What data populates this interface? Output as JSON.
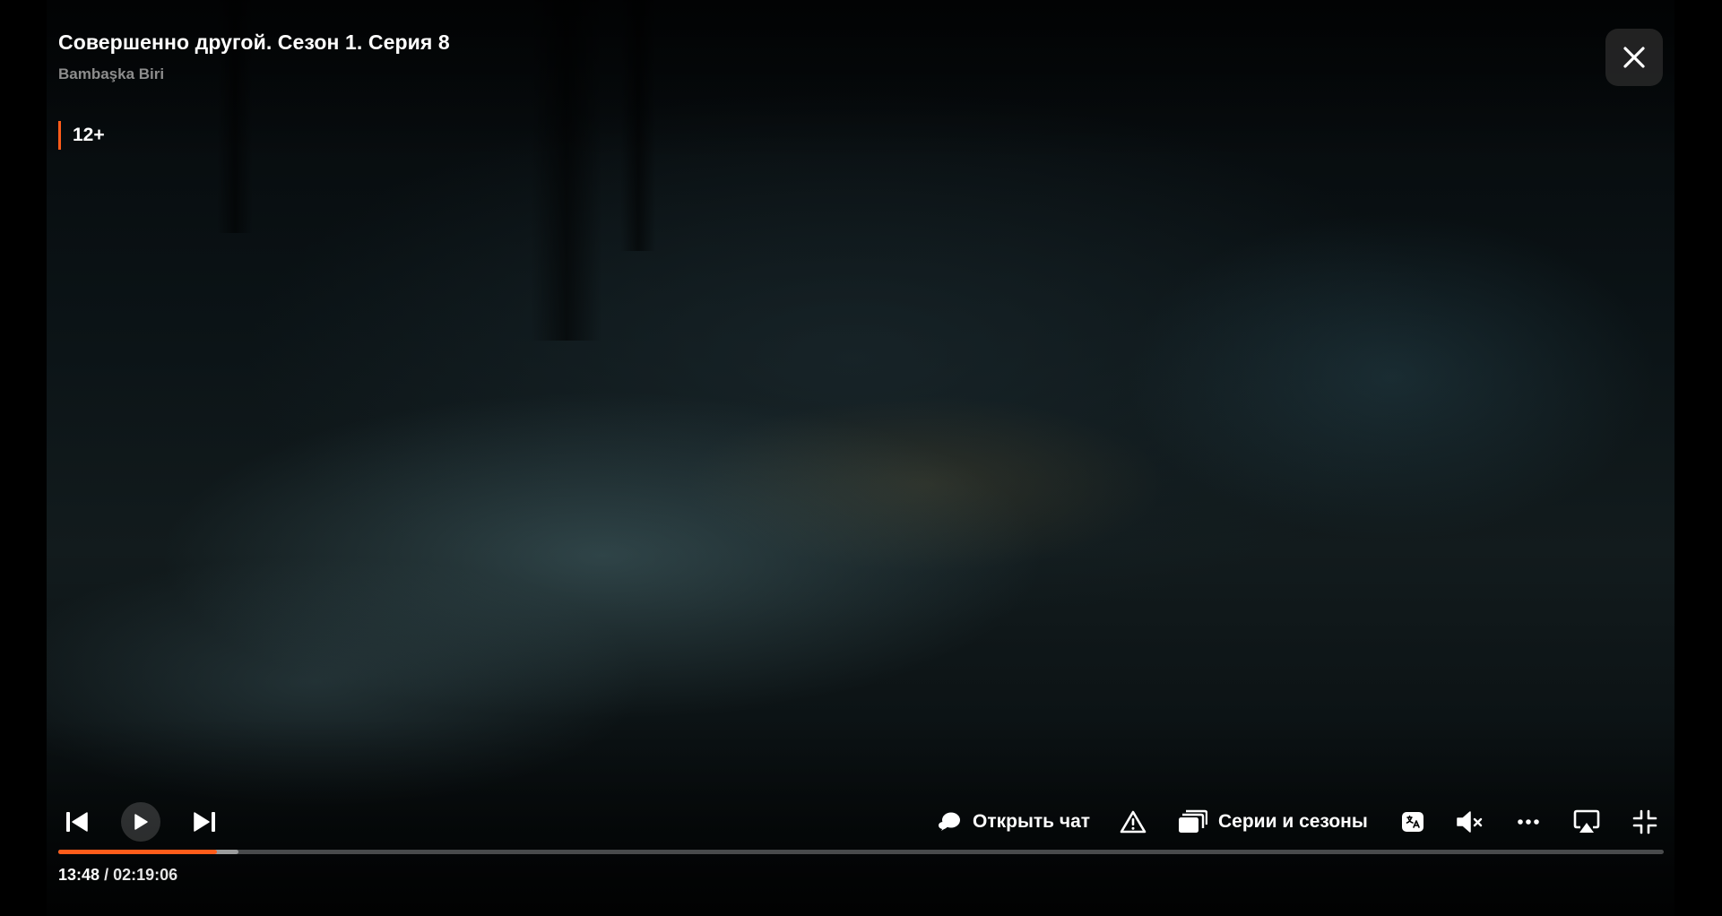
{
  "video": {
    "title": "Совершенно другой. Сезон 1. Серия 8",
    "original_title": "Bambaşka Biri",
    "age_rating": "12+"
  },
  "controls": {
    "previous_icon": "skip-previous-icon",
    "play_icon": "play-icon",
    "next_icon": "skip-next-icon",
    "chat_label": "Открыть чат",
    "report_icon": "warning-icon",
    "episodes_label": "Серии и сезоны",
    "subtitles_icon": "subtitles-icon",
    "volume_icon": "volume-muted-icon",
    "more_icon": "more-icon",
    "airplay_icon": "airplay-icon",
    "fullscreen_icon": "exit-fullscreen-icon",
    "close_icon": "close-icon"
  },
  "playback": {
    "current_time": "13:48",
    "separator": "/",
    "duration": "02:19:06",
    "progress_fraction": 0.099,
    "buffered_fraction": 0.112
  },
  "colors": {
    "accent": "#ff5c1a",
    "background": "#000000"
  }
}
